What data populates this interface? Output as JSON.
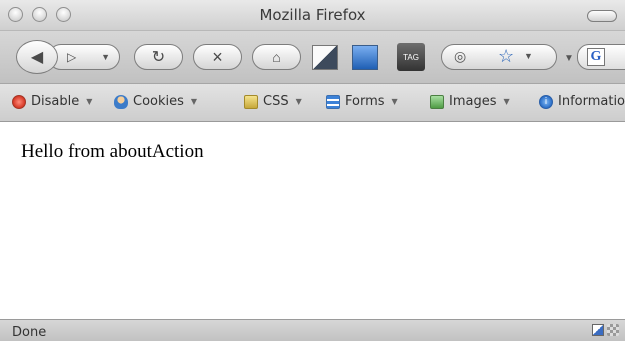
{
  "window": {
    "title": "Mozilla Firefox"
  },
  "navigation": {
    "back_icon": "back-arrow-icon",
    "forward_icon": "forward-arrow-icon",
    "reload_icon": "reload-icon",
    "stop_icon": "stop-icon",
    "home_icon": "home-icon",
    "bookmark_icon": "star-icon",
    "search_engine_icon": "google-icon",
    "tag_label": "TAG"
  },
  "devtoolbar": {
    "items": [
      {
        "label": "Disable",
        "icon": "disable-icon"
      },
      {
        "label": "Cookies",
        "icon": "cookies-icon"
      },
      {
        "label": "CSS",
        "icon": "css-icon"
      },
      {
        "label": "Forms",
        "icon": "forms-icon"
      },
      {
        "label": "Images",
        "icon": "images-icon"
      },
      {
        "label": "Information",
        "icon": "information-icon"
      }
    ]
  },
  "content": {
    "text": "Hello from aboutAction"
  },
  "status": {
    "text": "Done"
  },
  "colors": {
    "accent": "#2d66b8",
    "disable": "#d2311f"
  }
}
